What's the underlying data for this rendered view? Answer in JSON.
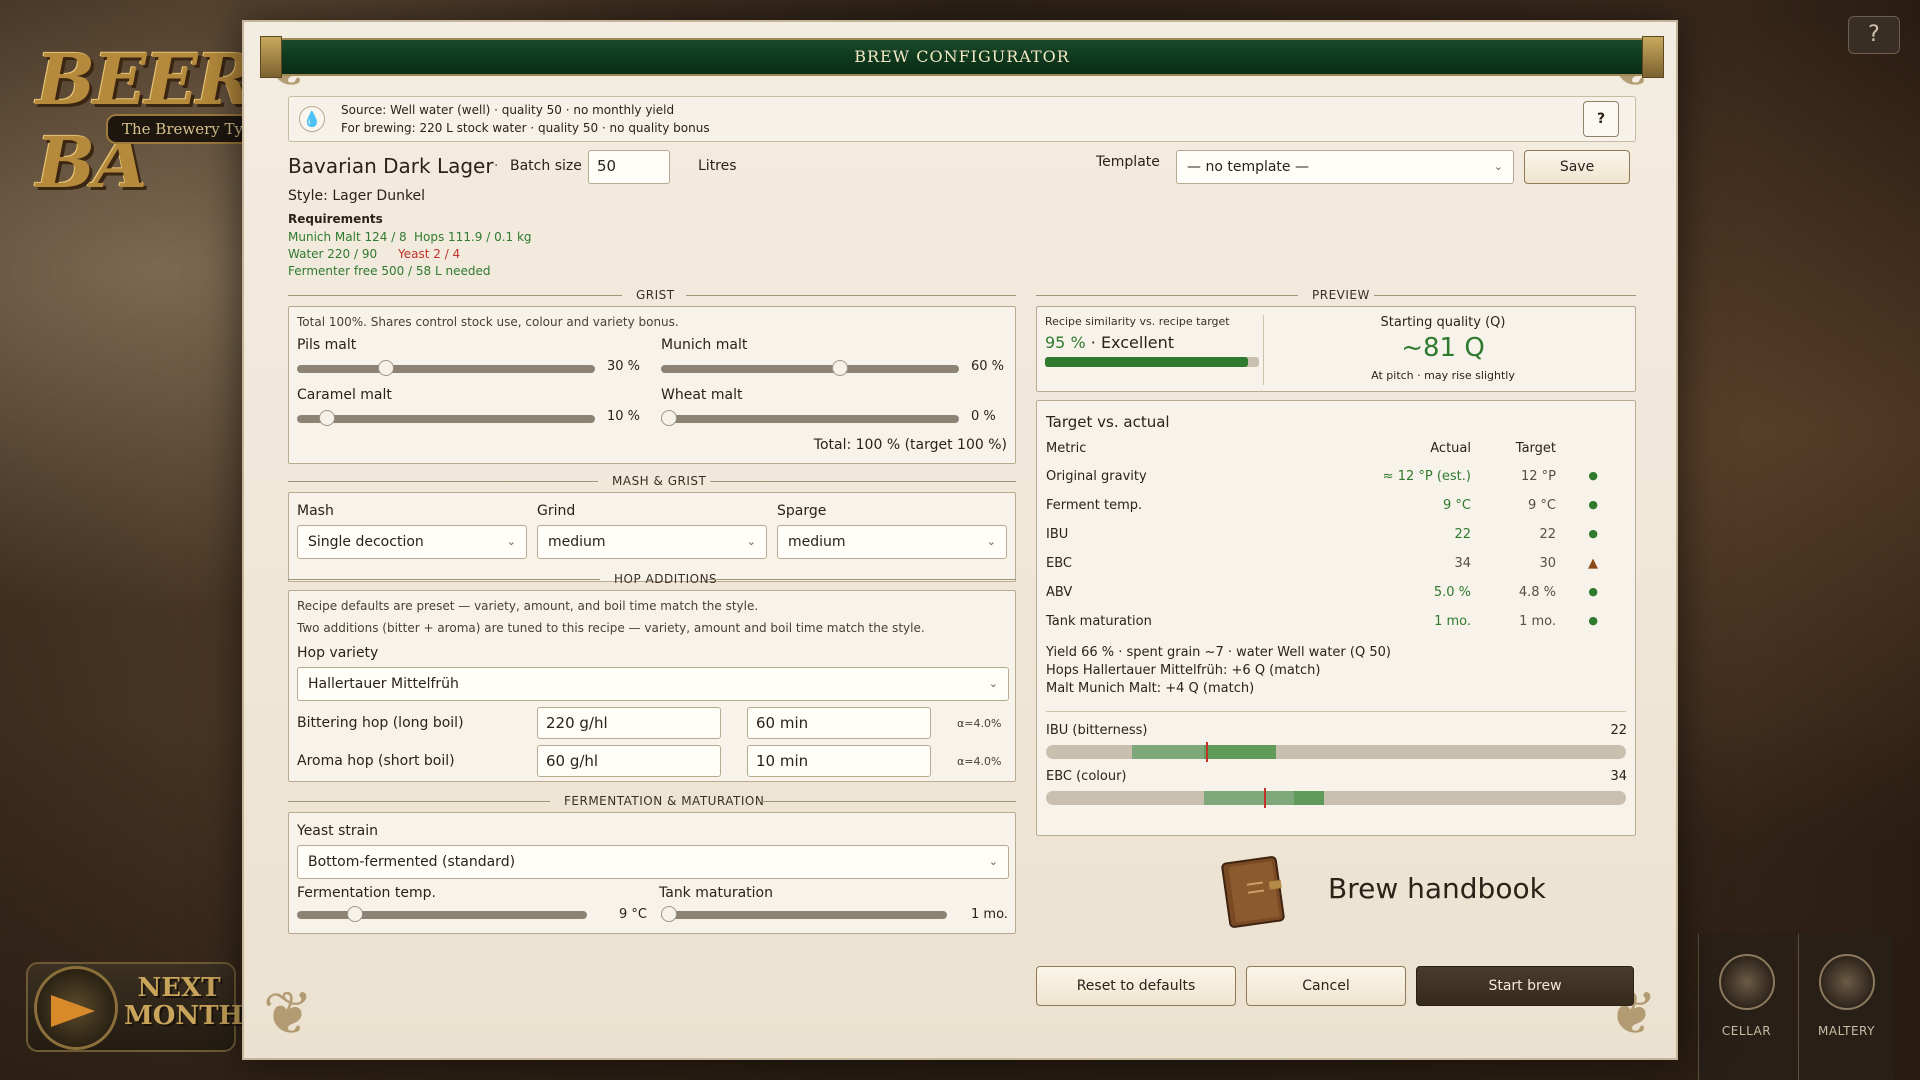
{
  "background": {
    "logo_text": "BEER BA",
    "logo_sub": "The Brewery Tyc",
    "help_label": "?",
    "next_month_label": "NEXT MONTH",
    "tiles": [
      {
        "label": "CELLAR"
      },
      {
        "label": "MALTERY"
      }
    ]
  },
  "dialog": {
    "title": "BREW CONFIGURATOR",
    "source": {
      "line1": "Source: Well water (well) · quality 50 · no monthly yield",
      "line2": "For brewing: 220 L stock water · quality 50 · no quality bonus",
      "help": "?"
    },
    "recipe_name": "Bavarian Dark Lager",
    "dot": "·",
    "batch_label": "Batch size",
    "batch_value": "50",
    "batch_unit": "Litres",
    "template_label": "Template",
    "template_value": "— no template —",
    "save_label": "Save",
    "style": "Style: Lager Dunkel",
    "requirements": {
      "title": "Requirements",
      "munich": "Munich Malt 124 / 8",
      "hops": "Hops 111.9 / 0.1 kg",
      "water": "Water 220 / 90",
      "yeast": "Yeast 2 / 4",
      "fermenter": "Fermenter free 500 / 58 L needed"
    }
  },
  "grist": {
    "title": "GRIST",
    "note": "Total 100%. Shares control stock use, colour and variety bonus.",
    "malts": [
      {
        "label": "Pils malt",
        "value": "30 %",
        "pct": 30
      },
      {
        "label": "Munich malt",
        "value": "60 %",
        "pct": 60
      },
      {
        "label": "Caramel malt",
        "value": "10 %",
        "pct": 10
      },
      {
        "label": "Wheat malt",
        "value": "0 %",
        "pct": 0
      }
    ],
    "total": "Total: 100 % (target 100 %)"
  },
  "mash": {
    "title": "MASH & GRIST",
    "mash_label": "Mash",
    "mash_value": "Single decoction",
    "grind_label": "Grind",
    "grind_value": "medium",
    "sparge_label": "Sparge",
    "sparge_value": "medium"
  },
  "hops": {
    "title": "HOP ADDITIONS",
    "note1": "Recipe defaults are preset — variety, amount, and boil time match the style.",
    "note2": "Two additions (bitter + aroma) are tuned to this recipe — variety, amount and boil time match the style.",
    "variety_label": "Hop variety",
    "variety_value": "Hallertauer Mittelfrüh",
    "bitter_label": "Bittering hop (long boil)",
    "bitter_amount": "220 g/hl",
    "bitter_time": "60 min",
    "bitter_alpha": "α=4.0%",
    "aroma_label": "Aroma hop (short boil)",
    "aroma_amount": "60 g/hl",
    "aroma_time": "10 min",
    "aroma_alpha": "α=4.0%"
  },
  "fermentation": {
    "title": "FERMENTATION & MATURATION",
    "yeast_label": "Yeast strain",
    "yeast_value": "Bottom-fermented (standard)",
    "temp_label": "Fermentation temp.",
    "temp_value": "9 °C",
    "temp_level": 0.2,
    "tank_label": "Tank maturation",
    "tank_value": "1 mo.",
    "tank_level": 0.0
  },
  "preview": {
    "title": "PREVIEW",
    "sim_label": "Recipe similarity vs. recipe target",
    "sim_pct": "95 %",
    "sim_sep": "·",
    "sim_rating": "Excellent",
    "sim_fill": 0.95,
    "q_title": "Starting quality (Q)",
    "q_value": "~81 Q",
    "q_sub": "At pitch · may rise slightly"
  },
  "tva": {
    "title": "Target vs. actual",
    "head": {
      "metric": "Metric",
      "actual": "Actual",
      "target": "Target"
    },
    "rows": [
      {
        "metric": "Original gravity",
        "actual": "≈ 12 °P (est.)",
        "target": "12 °P",
        "status": "●"
      },
      {
        "metric": "Ferment temp.",
        "actual": "9 °C",
        "target": "9 °C",
        "status": "●"
      },
      {
        "metric": "IBU",
        "actual": "22",
        "target": "22",
        "status": "●"
      },
      {
        "metric": "EBC",
        "actual": "34",
        "target": "30",
        "status": "▲"
      },
      {
        "metric": "ABV",
        "actual": "5.0 %",
        "target": "4.8 %",
        "status": "●"
      },
      {
        "metric": "Tank maturation",
        "actual": "1 mo.",
        "target": "1 mo.",
        "status": "●"
      }
    ],
    "yield_line": "Yield 66 % · spent grain ~7 · water Well water (Q 50)",
    "hops_line": "Hops Hallertauer Mittelfrüh: +6 Q (match)",
    "malt_line": "Malt Munich Malt: +4 Q (match)",
    "ibu_label": "IBU (bitterness)",
    "ibu_value": "22",
    "ibu_marker": 0.275,
    "ebc_label": "EBC (colour)",
    "ebc_value": "34",
    "ebc_marker": 0.375
  },
  "handbook_label": "Brew handbook",
  "actions": {
    "reset": "Reset to defaults",
    "cancel": "Cancel",
    "start": "Start brew"
  },
  "colors": {
    "accent_green": "#2f7a2f",
    "error_red": "#c0322a",
    "title_green": "#0f3a1e"
  }
}
